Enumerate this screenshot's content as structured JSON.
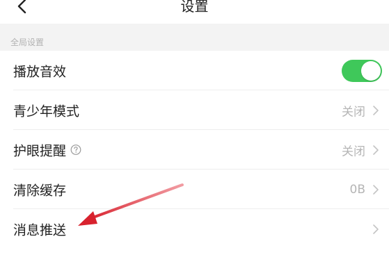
{
  "header": {
    "title": "设置",
    "back_icon": "back-chevron-icon"
  },
  "section": {
    "label": "全局设置"
  },
  "rows": [
    {
      "label": "播放音效",
      "control": "toggle",
      "toggle_on": true
    },
    {
      "label": "青少年模式",
      "value": "关闭"
    },
    {
      "label": "护眼提醒",
      "value": "关闭",
      "has_help_icon": true
    },
    {
      "label": "清除缓存",
      "value": "0B"
    },
    {
      "label": "消息推送",
      "value": ""
    }
  ],
  "colors": {
    "toggle_on": "#3fc85a",
    "annotation_arrow": "#e0303a",
    "section_bg": "#f3f3f3",
    "muted_text": "#b5b5b5"
  }
}
